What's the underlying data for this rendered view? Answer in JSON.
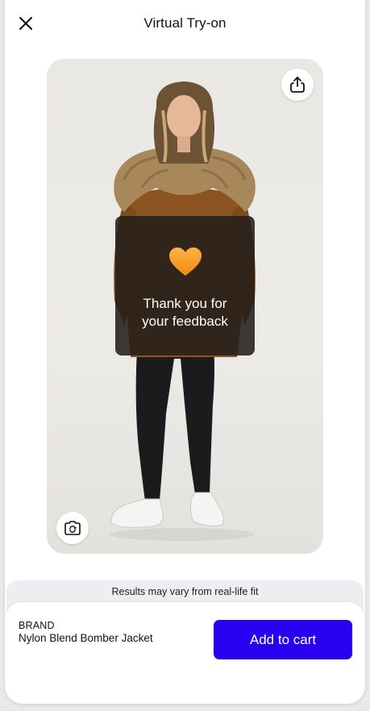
{
  "header": {
    "title": "Virtual Try-on",
    "close_icon": "close-icon"
  },
  "photo": {
    "share_icon": "share-icon",
    "camera_icon": "camera-switch-icon"
  },
  "toast": {
    "emoji": "🧡",
    "message": "Thank you for your feedback"
  },
  "disclaimer": {
    "text": "Results may vary from real-life fit"
  },
  "product": {
    "brand": "BRAND",
    "name": "Nylon Blend Bomber Jacket",
    "add_to_cart_label": "Add to cart"
  },
  "colors": {
    "accent": "#2a00f0",
    "toast_bg": "#241e1a",
    "heart": "#f7941d"
  }
}
